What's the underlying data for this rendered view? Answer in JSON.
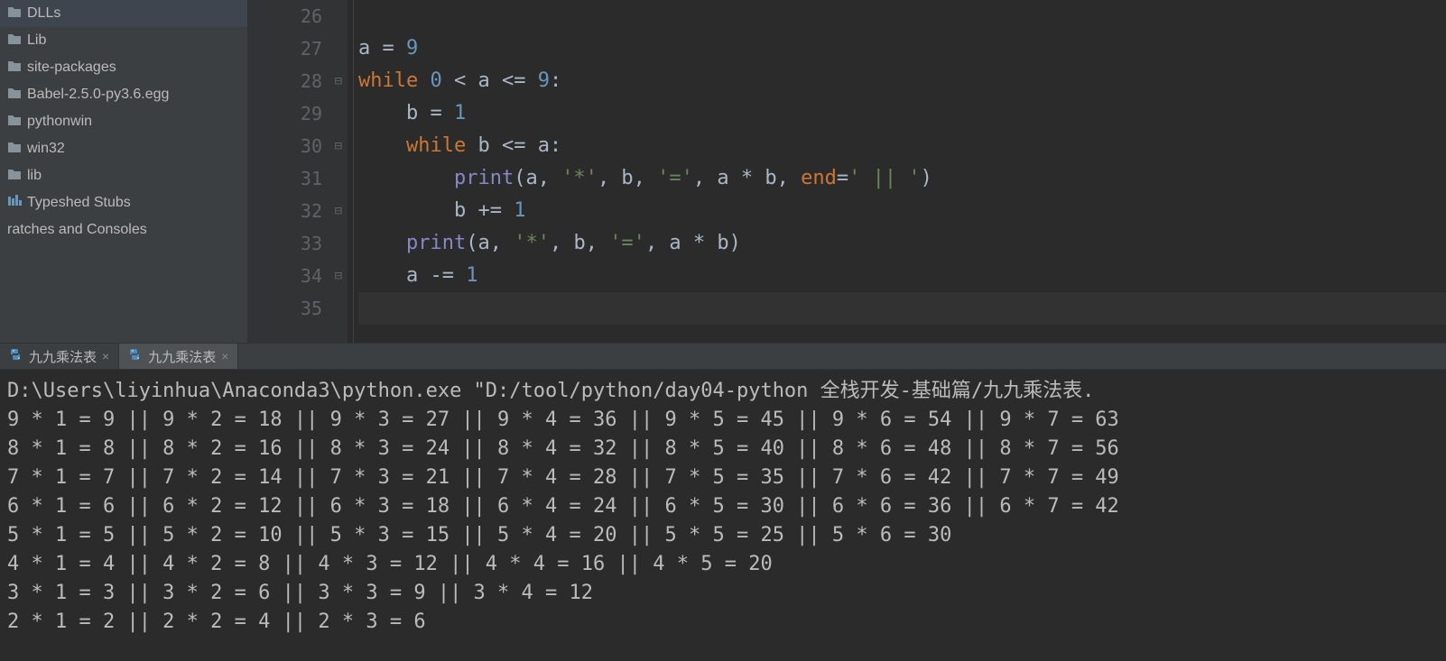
{
  "sidebar": {
    "items": [
      {
        "label": "DLLs",
        "icon": "folder"
      },
      {
        "label": "Lib",
        "icon": "folder"
      },
      {
        "label": "site-packages",
        "icon": "folder"
      },
      {
        "label": "Babel-2.5.0-py3.6.egg",
        "icon": "folder"
      },
      {
        "label": "pythonwin",
        "icon": "folder"
      },
      {
        "label": "win32",
        "icon": "folder"
      },
      {
        "label": "lib",
        "icon": "folder"
      },
      {
        "label": "Typeshed Stubs",
        "icon": "typeshed"
      }
    ],
    "scratches_label": "ratches and Consoles"
  },
  "editor": {
    "lines": [
      {
        "num": 26,
        "code": ""
      },
      {
        "num": 27,
        "code": "a = 9"
      },
      {
        "num": 28,
        "code": "while 0 < a <= 9:"
      },
      {
        "num": 29,
        "code": "    b = 1"
      },
      {
        "num": 30,
        "code": "    while b <= a:"
      },
      {
        "num": 31,
        "code": "        print(a, '*', b, '=', a * b, end=' || ')"
      },
      {
        "num": 32,
        "code": "        b += 1"
      },
      {
        "num": 33,
        "code": "    print(a, '*', b, '=', a * b)"
      },
      {
        "num": 34,
        "code": "    a -= 1"
      },
      {
        "num": 35,
        "code": ""
      }
    ]
  },
  "tabs": [
    {
      "label": "九九乘法表",
      "active": false
    },
    {
      "label": "九九乘法表",
      "active": true
    }
  ],
  "console": {
    "command": "D:\\Users\\liyinhua\\Anaconda3\\python.exe \"D:/tool/python/day04-python 全栈开发-基础篇/九九乘法表.",
    "output": [
      "9 * 1 = 9 || 9 * 2 = 18 || 9 * 3 = 27 || 9 * 4 = 36 || 9 * 5 = 45 || 9 * 6 = 54 || 9 * 7 = 63",
      "8 * 1 = 8 || 8 * 2 = 16 || 8 * 3 = 24 || 8 * 4 = 32 || 8 * 5 = 40 || 8 * 6 = 48 || 8 * 7 = 56",
      "7 * 1 = 7 || 7 * 2 = 14 || 7 * 3 = 21 || 7 * 4 = 28 || 7 * 5 = 35 || 7 * 6 = 42 || 7 * 7 = 49",
      "6 * 1 = 6 || 6 * 2 = 12 || 6 * 3 = 18 || 6 * 4 = 24 || 6 * 5 = 30 || 6 * 6 = 36 || 6 * 7 = 42",
      "5 * 1 = 5 || 5 * 2 = 10 || 5 * 3 = 15 || 5 * 4 = 20 || 5 * 5 = 25 || 5 * 6 = 30",
      "4 * 1 = 4 || 4 * 2 = 8 || 4 * 3 = 12 || 4 * 4 = 16 || 4 * 5 = 20",
      "3 * 1 = 3 || 3 * 2 = 6 || 3 * 3 = 9 || 3 * 4 = 12",
      "2 * 1 = 2 || 2 * 2 = 4 || 2 * 3 = 6"
    ]
  }
}
